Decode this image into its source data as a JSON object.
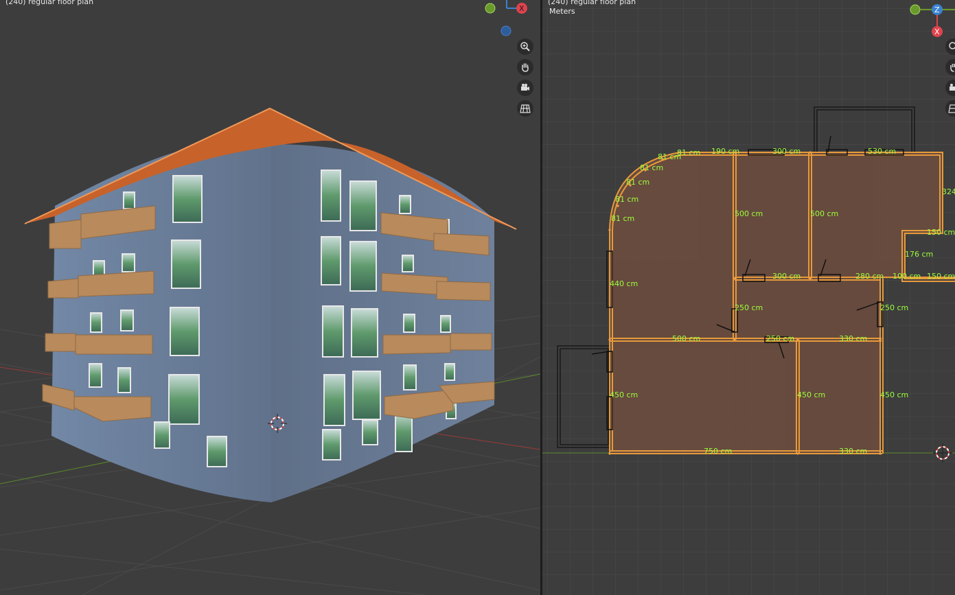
{
  "left_viewport": {
    "header": "(240) regular floor plan",
    "nav_gizmo_axes": [
      "X"
    ],
    "nav_buttons": [
      "zoom-icon",
      "hand-pan-icon",
      "camera-icon",
      "grid-ortho-icon"
    ]
  },
  "right_viewport": {
    "header": "(240) regular floor plan",
    "units": "Meters",
    "nav_gizmo_axes": [
      "Z",
      "X"
    ],
    "dimensions": {
      "arc1": "81 cm",
      "arc2": "81 cm",
      "arc3": "81 cm",
      "arc4": "81 cm",
      "arc5": "81 cm",
      "arc6": "81 cm",
      "top_190": "190 cm",
      "top_300": "300 cm",
      "top_530": "530 cm",
      "right_324": "324",
      "mid_500a": "500 cm",
      "mid_500b": "500 cm",
      "mid_150a": "150 cm",
      "mid_176": "176 cm",
      "corr_300": "300 cm",
      "corr_280": "280 cm",
      "corr_100": "100 cm",
      "corr_150": "150 cm",
      "left_440": "440 cm",
      "c_250a": "250 cm",
      "c_250b": "250 cm",
      "row_500": "500 cm",
      "row_250": "250 cm",
      "row_330": "330 cm",
      "low_450a": "450 cm",
      "low_450b": "450 cm",
      "low_450c": "450 cm",
      "bot_750": "750 cm",
      "bot_330": "330 cm"
    }
  },
  "colors": {
    "viewport_bg": "#3d3d3d",
    "grid": "#4a4a4a",
    "room_fill": "#6a4c3e",
    "wall_orange": "#e89a3a",
    "dim_green": "#9dff3d",
    "building_wall": "#6c7e98",
    "roof": "#c7622a",
    "balcony": "#b88a5c"
  }
}
